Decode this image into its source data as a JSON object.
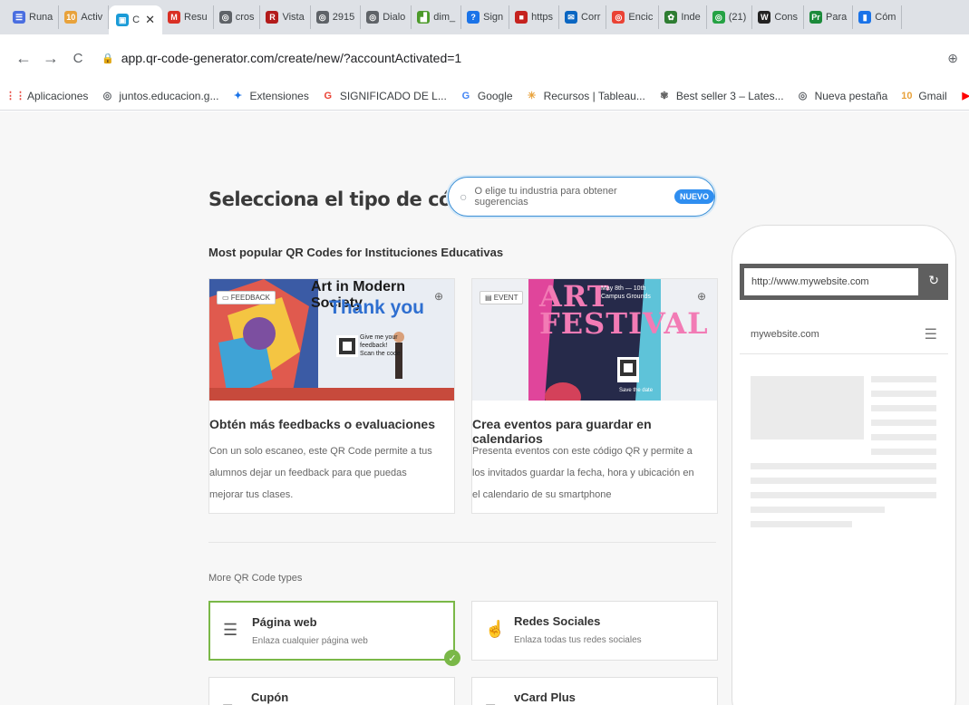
{
  "browser": {
    "tabs": [
      {
        "label": "Runa",
        "color": "#4a6ee0",
        "glyph": "☰"
      },
      {
        "label": "Activ",
        "color": "#e8a23b",
        "glyph": "10"
      },
      {
        "label": "C",
        "color": "#1a9bd7",
        "glyph": "▣",
        "active": true
      },
      {
        "label": "Resu",
        "color": "#d93025",
        "glyph": "M"
      },
      {
        "label": "cros",
        "color": "#5f6368",
        "glyph": "◎"
      },
      {
        "label": "Vista",
        "color": "#b31b1b",
        "glyph": "R"
      },
      {
        "label": "2915",
        "color": "#5f6368",
        "glyph": "◎"
      },
      {
        "label": "Dialo",
        "color": "#5f6368",
        "glyph": "◎"
      },
      {
        "label": "dim_",
        "color": "#4c9a2a",
        "glyph": "▟"
      },
      {
        "label": "Sign",
        "color": "#1a73e8",
        "glyph": "?"
      },
      {
        "label": "https",
        "color": "#c5221f",
        "glyph": "■"
      },
      {
        "label": "Corr",
        "color": "#0a66c2",
        "glyph": "✉"
      },
      {
        "label": "Encic",
        "color": "#ea4335",
        "glyph": "◎"
      },
      {
        "label": "Inde",
        "color": "#2e7d32",
        "glyph": "✿"
      },
      {
        "label": "(21)",
        "color": "#25a244",
        "glyph": "◎"
      },
      {
        "label": "Cons",
        "color": "#222222",
        "glyph": "W"
      },
      {
        "label": "Para",
        "color": "#1b8a3a",
        "glyph": "Pr"
      },
      {
        "label": "Cóm",
        "color": "#1a73e8",
        "glyph": "▮"
      }
    ],
    "close_glyph": "✕",
    "back": "←",
    "forward": "→",
    "reload": "C",
    "url": "app.qr-code-generator.com/create/new/?accountActivated=1",
    "zoom_icon": "zoom-icon",
    "bookmarks": [
      {
        "label": "Aplicaciones",
        "glyph": "⋮⋮",
        "color": "#e8453c"
      },
      {
        "label": "juntos.educacion.g...",
        "glyph": "◎",
        "color": "#5f6368"
      },
      {
        "label": "Extensiones",
        "glyph": "✦",
        "color": "#1a73e8"
      },
      {
        "label": "SIGNIFICADO DE L...",
        "glyph": "G",
        "color": "#ea4335"
      },
      {
        "label": "Google",
        "glyph": "G",
        "color": "#4285f4"
      },
      {
        "label": "Recursos | Tableau...",
        "glyph": "✳",
        "color": "#e8a23b"
      },
      {
        "label": "Best seller 3 – Lates...",
        "glyph": "✾",
        "color": "#666"
      },
      {
        "label": "Nueva pestaña",
        "glyph": "◎",
        "color": "#5f6368"
      },
      {
        "label": "Gmail",
        "glyph": "10",
        "color": "#e8a23b"
      },
      {
        "label": "YouTube",
        "glyph": "▶",
        "color": "#ff0000"
      }
    ]
  },
  "page": {
    "heading": "Selecciona el tipo de código QR",
    "search": {
      "placeholder": "O elige tu industria para obtener sugerencias",
      "badge": "NUEVO"
    },
    "popular_title": "Most popular QR Codes for Instituciones Educativas",
    "cards": [
      {
        "tag": "FEEDBACK",
        "image_line1": "Art in Modern Society",
        "image_line2": "Thank you",
        "image_line3": "Give me your feedback! Scan the code",
        "title": "Obtén más feedbacks o evaluaciones",
        "description": "Con un solo escaneo, este QR Code permite a tus alumnos dejar un feedback para que puedas mejorar tus clases."
      },
      {
        "tag": "EVENT",
        "image_line1": "ART FESTIVAL",
        "image_line2": "May 8th — 10th Campus Grounds",
        "image_line3": "Save the date",
        "title": "Crea eventos para guardar en calendarios",
        "description": "Presenta eventos con este código QR y permite a los invitados guardar la fecha, hora y ubicación en el calendario de su smartphone"
      }
    ],
    "more_title": "More QR Code types",
    "types": [
      {
        "name": "Página web",
        "sub": "Enlaza cualquier página web",
        "icon": "☰"
      },
      {
        "name": "Redes Sociales",
        "sub": "Enlaza todas tus redes sociales",
        "icon": "👍"
      },
      {
        "name": "Cupón",
        "sub": "",
        "icon": "%"
      },
      {
        "name": "vCard Plus",
        "sub": "",
        "icon": "▤"
      }
    ],
    "preview": {
      "url": "http://www.mywebsite.com",
      "site": "mywebsite.com"
    }
  }
}
